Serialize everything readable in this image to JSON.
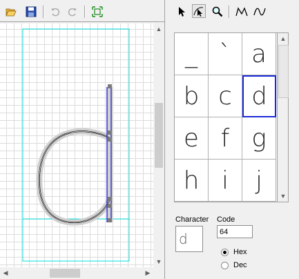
{
  "toolbar_left": {
    "buttons": [
      {
        "name": "open-folder-icon"
      },
      {
        "name": "save-icon"
      },
      {
        "name": "undo-icon",
        "disabled": true
      },
      {
        "name": "redo-icon",
        "disabled": true
      },
      {
        "name": "fit-to-view-icon"
      }
    ]
  },
  "toolbar_right": {
    "buttons": [
      {
        "name": "select-arrow-icon"
      },
      {
        "name": "node-select-icon",
        "active": true
      },
      {
        "name": "zoom-icon"
      },
      {
        "name": "line-tool-icon"
      },
      {
        "name": "curve-tool-icon"
      }
    ]
  },
  "glyph_grid": {
    "cells": [
      {
        "char": "_"
      },
      {
        "char": "`"
      },
      {
        "char": "a"
      },
      {
        "char": "b"
      },
      {
        "char": "c"
      },
      {
        "char": "d",
        "selected": true
      },
      {
        "char": "e"
      },
      {
        "char": "f"
      },
      {
        "char": "g"
      },
      {
        "char": "h"
      },
      {
        "char": "i"
      },
      {
        "char": "j"
      }
    ]
  },
  "info": {
    "character_label": "Character",
    "character_value": "d",
    "code_label": "Code",
    "code_value": "64",
    "hex_label": "Hex",
    "dec_label": "Dec",
    "hex_checked": true
  },
  "colors": {
    "guide": "#00e0e0",
    "contour": "#2a2ad0",
    "grid_selection": "#1a2ad6"
  }
}
